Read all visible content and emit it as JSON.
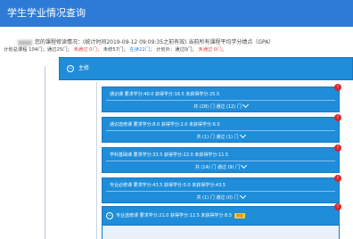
{
  "header": {
    "title": "学生学业情况查询"
  },
  "summary": {
    "line1_a": "您的课程修读情况：(统计时间2019-09-12 09:09:35之前有效) 当前所有课程平均学分绩点（GPA）",
    "line2_a": "计划总课程 104门；通过25门；",
    "line2_red1": "未通过 0门；",
    "line2_b": "未修57门；",
    "line2_blue": "在读22门；",
    "line2_c": "计划外：通过0门；",
    "line2_red2": "未通过 0门；"
  },
  "tree": {
    "root_label": "主修",
    "root_toggle": "−",
    "cards": [
      {
        "line1": "通识课  要求学分:40.0  获得学分:16.5  未获得学分:25.5",
        "line2": "共 (28) 门  通过 (12) 门",
        "badge": "!"
      },
      {
        "line1": "通识选修课  要求学分:8.0  获得学分:2.0  未获得学分:6.0",
        "line2": "共 (1) 门  通过 (1) 门",
        "badge": "!"
      },
      {
        "line1": "学科基础课  要求学分:33.5  获得学分:22.0  未获得学分:11.5",
        "line2": "共 (14) 门  通过 (9) 门",
        "badge": "!"
      },
      {
        "line1": "专业必修课  要求学分:43.5  获得学分:0.0  未获得学分:43.5",
        "line2": "共 (1) 门  通过 (0) 门",
        "badge": "!"
      }
    ],
    "card5": {
      "toggle": "−",
      "line1": "专业选修课  要求学分:21.0  获得学分:12.5  未获得学分:8.5",
      "tag": "收起",
      "badge": "!"
    }
  }
}
